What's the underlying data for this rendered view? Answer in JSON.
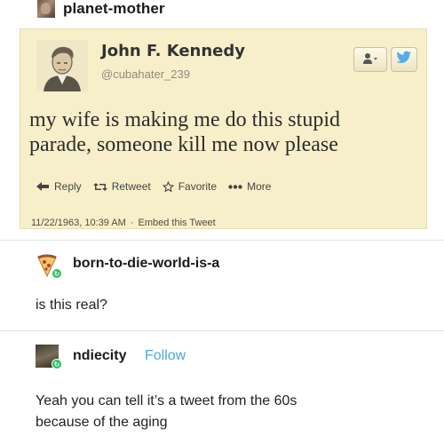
{
  "post": {
    "username": "planet-mother",
    "avatar_icon": "photo-avatar"
  },
  "tweet": {
    "author_name": "John F. Kennedy",
    "handle": "@cubahater_239",
    "text_line1": "my wife is making me do this stupid",
    "text_line2": "parade, someone kill me now please",
    "follow_icon": "person-add-icon",
    "bird_icon": "twitter-bird-icon",
    "actions": {
      "reply": "Reply",
      "retweet": "Retweet",
      "favorite": "Favorite",
      "more": "More"
    },
    "timestamp": "11/22/1963, 10:39 AM",
    "embed": "Embed this Tweet",
    "colors": {
      "card_bg": "#f7efc9",
      "bird": "#55acee"
    }
  },
  "reblogs": [
    {
      "username": "born-to-die-world-is-a",
      "avatar_icon": "pizza-avatar",
      "text": "is this real?"
    },
    {
      "username": "ndiecity",
      "follow_label": "Follow",
      "avatar_icon": "photo-avatar",
      "text_line1": "Yeah you can tell it’s a tweet from the 60s",
      "text_line2": "because of the aging"
    }
  ],
  "colors": {
    "follow_link": "#4aa8d8",
    "badge": "#2dbf5e"
  }
}
